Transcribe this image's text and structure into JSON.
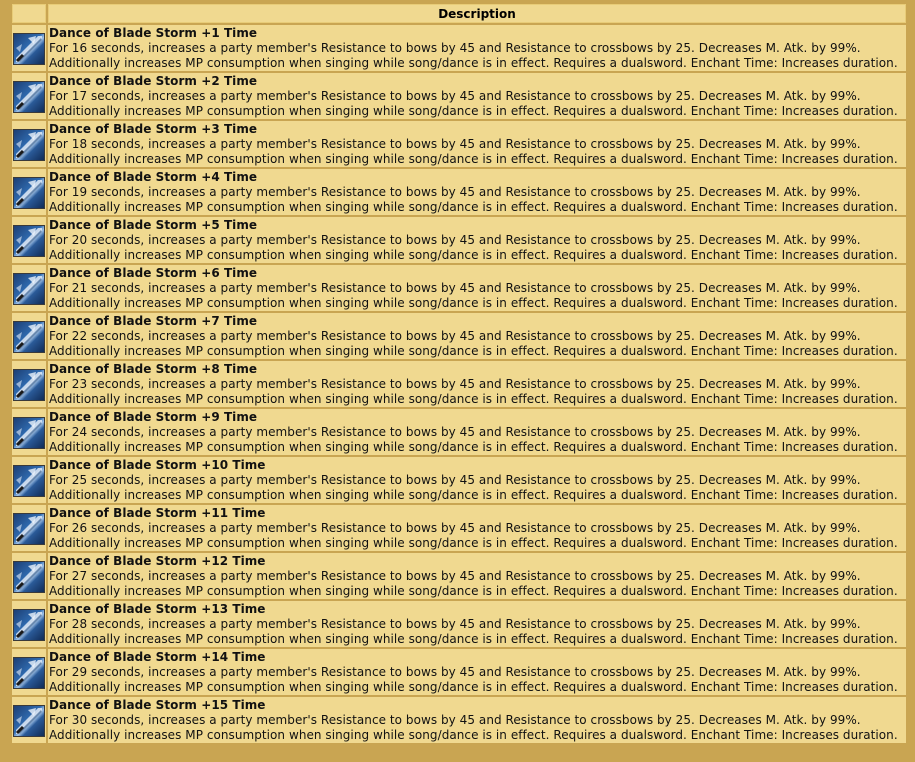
{
  "table": {
    "header": {
      "description": "Description"
    },
    "rows": [
      {
        "name": "Dance of Blade Storm +1 Time",
        "line1": "For 16 seconds, increases a party member's Resistance to bows by 45 and Resistance to crossbows by 25. Decreases M. Atk. by 99%.",
        "line2": "Additionally increases MP consumption when singing while song/dance is in effect. Requires a dualsword. Enchant Time: Increases duration.",
        "icon": "blade-storm-skill-icon"
      },
      {
        "name": "Dance of Blade Storm +2 Time",
        "line1": "For 17 seconds, increases a party member's Resistance to bows by 45 and Resistance to crossbows by 25. Decreases M. Atk. by 99%.",
        "line2": "Additionally increases MP consumption when singing while song/dance is in effect. Requires a dualsword. Enchant Time: Increases duration.",
        "icon": "blade-storm-skill-icon"
      },
      {
        "name": "Dance of Blade Storm +3 Time",
        "line1": "For 18 seconds, increases a party member's Resistance to bows by 45 and Resistance to crossbows by 25. Decreases M. Atk. by 99%.",
        "line2": "Additionally increases MP consumption when singing while song/dance is in effect. Requires a dualsword. Enchant Time: Increases duration.",
        "icon": "blade-storm-skill-icon"
      },
      {
        "name": "Dance of Blade Storm +4 Time",
        "line1": "For 19 seconds, increases a party member's Resistance to bows by 45 and Resistance to crossbows by 25. Decreases M. Atk. by 99%.",
        "line2": "Additionally increases MP consumption when singing while song/dance is in effect. Requires a dualsword. Enchant Time: Increases duration.",
        "icon": "blade-storm-skill-icon"
      },
      {
        "name": "Dance of Blade Storm +5 Time",
        "line1": "For 20 seconds, increases a party member's Resistance to bows by 45 and Resistance to crossbows by 25. Decreases M. Atk. by 99%.",
        "line2": "Additionally increases MP consumption when singing while song/dance is in effect. Requires a dualsword. Enchant Time: Increases duration.",
        "icon": "blade-storm-skill-icon"
      },
      {
        "name": "Dance of Blade Storm +6 Time",
        "line1": "For 21 seconds, increases a party member's Resistance to bows by 45 and Resistance to crossbows by 25. Decreases M. Atk. by 99%.",
        "line2": "Additionally increases MP consumption when singing while song/dance is in effect. Requires a dualsword. Enchant Time: Increases duration.",
        "icon": "blade-storm-skill-icon"
      },
      {
        "name": "Dance of Blade Storm +7 Time",
        "line1": "For 22 seconds, increases a party member's Resistance to bows by 45 and Resistance to crossbows by 25. Decreases M. Atk. by 99%.",
        "line2": "Additionally increases MP consumption when singing while song/dance is in effect. Requires a dualsword. Enchant Time: Increases duration.",
        "icon": "blade-storm-skill-icon"
      },
      {
        "name": "Dance of Blade Storm +8 Time",
        "line1": "For 23 seconds, increases a party member's Resistance to bows by 45 and Resistance to crossbows by 25. Decreases M. Atk. by 99%.",
        "line2": "Additionally increases MP consumption when singing while song/dance is in effect. Requires a dualsword. Enchant Time: Increases duration.",
        "icon": "blade-storm-skill-icon"
      },
      {
        "name": "Dance of Blade Storm +9 Time",
        "line1": "For 24 seconds, increases a party member's Resistance to bows by 45 and Resistance to crossbows by 25. Decreases M. Atk. by 99%.",
        "line2": "Additionally increases MP consumption when singing while song/dance is in effect. Requires a dualsword. Enchant Time: Increases duration.",
        "icon": "blade-storm-skill-icon"
      },
      {
        "name": "Dance of Blade Storm +10 Time",
        "line1": "For 25 seconds, increases a party member's Resistance to bows by 45 and Resistance to crossbows by 25. Decreases M. Atk. by 99%.",
        "line2": "Additionally increases MP consumption when singing while song/dance is in effect. Requires a dualsword. Enchant Time: Increases duration.",
        "icon": "blade-storm-skill-icon"
      },
      {
        "name": "Dance of Blade Storm +11 Time",
        "line1": "For 26 seconds, increases a party member's Resistance to bows by 45 and Resistance to crossbows by 25. Decreases M. Atk. by 99%.",
        "line2": "Additionally increases MP consumption when singing while song/dance is in effect. Requires a dualsword. Enchant Time: Increases duration.",
        "icon": "blade-storm-skill-icon"
      },
      {
        "name": "Dance of Blade Storm +12 Time",
        "line1": "For 27 seconds, increases a party member's Resistance to bows by 45 and Resistance to crossbows by 25. Decreases M. Atk. by 99%.",
        "line2": "Additionally increases MP consumption when singing while song/dance is in effect. Requires a dualsword. Enchant Time: Increases duration.",
        "icon": "blade-storm-skill-icon"
      },
      {
        "name": "Dance of Blade Storm +13 Time",
        "line1": "For 28 seconds, increases a party member's Resistance to bows by 45 and Resistance to crossbows by 25. Decreases M. Atk. by 99%.",
        "line2": "Additionally increases MP consumption when singing while song/dance is in effect. Requires a dualsword. Enchant Time: Increases duration.",
        "icon": "blade-storm-skill-icon"
      },
      {
        "name": "Dance of Blade Storm +14 Time",
        "line1": "For 29 seconds, increases a party member's Resistance to bows by 45 and Resistance to crossbows by 25. Decreases M. Atk. by 99%.",
        "line2": "Additionally increases MP consumption when singing while song/dance is in effect. Requires a dualsword. Enchant Time: Increases duration.",
        "icon": "blade-storm-skill-icon"
      },
      {
        "name": "Dance of Blade Storm +15 Time",
        "line1": "For 30 seconds, increases a party member's Resistance to bows by 45 and Resistance to crossbows by 25. Decreases M. Atk. by 99%.",
        "line2": "Additionally increases MP consumption when singing while song/dance is in effect. Requires a dualsword. Enchant Time: Increases duration.",
        "icon": "blade-storm-skill-icon"
      }
    ]
  },
  "colors": {
    "page_background": "#c9a552",
    "cell_background": "#f0d990",
    "icon_blue": "#2f6bb0"
  }
}
